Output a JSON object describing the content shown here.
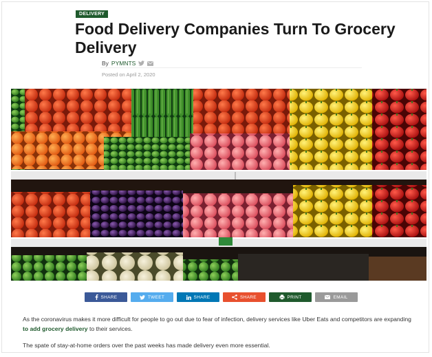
{
  "article": {
    "category": "DELIVERY",
    "title": "Food Delivery Companies Turn To Grocery Delivery",
    "byline_prefix": "By",
    "author": "PYMNTS",
    "posted": "Posted on April 2, 2020"
  },
  "hero_image": {
    "alt": "Grocery produce shelves"
  },
  "share_buttons": [
    {
      "label": "SHARE",
      "icon": "facebook-icon",
      "color": "#3b5998"
    },
    {
      "label": "TWEET",
      "icon": "twitter-icon",
      "color": "#55acee"
    },
    {
      "label": "SHARE",
      "icon": "linkedin-icon",
      "color": "#0077b5"
    },
    {
      "label": "SHARE",
      "icon": "share-icon",
      "color": "#e8502e"
    },
    {
      "label": "PRINT",
      "icon": "print-icon",
      "color": "#1f5a2d"
    },
    {
      "label": "EMAIL",
      "icon": "email-icon",
      "color": "#9a9a9a"
    }
  ],
  "body": {
    "p1_before": "As the coronavirus makes it more difficult for people to go out due to fear of infection, delivery services like Uber Eats and competitors are expanding ",
    "p1_link": "to add grocery delivery",
    "p1_after": " to their services.",
    "p2": "The spate of stay-at-home orders over the past weeks has made delivery even more essential."
  }
}
